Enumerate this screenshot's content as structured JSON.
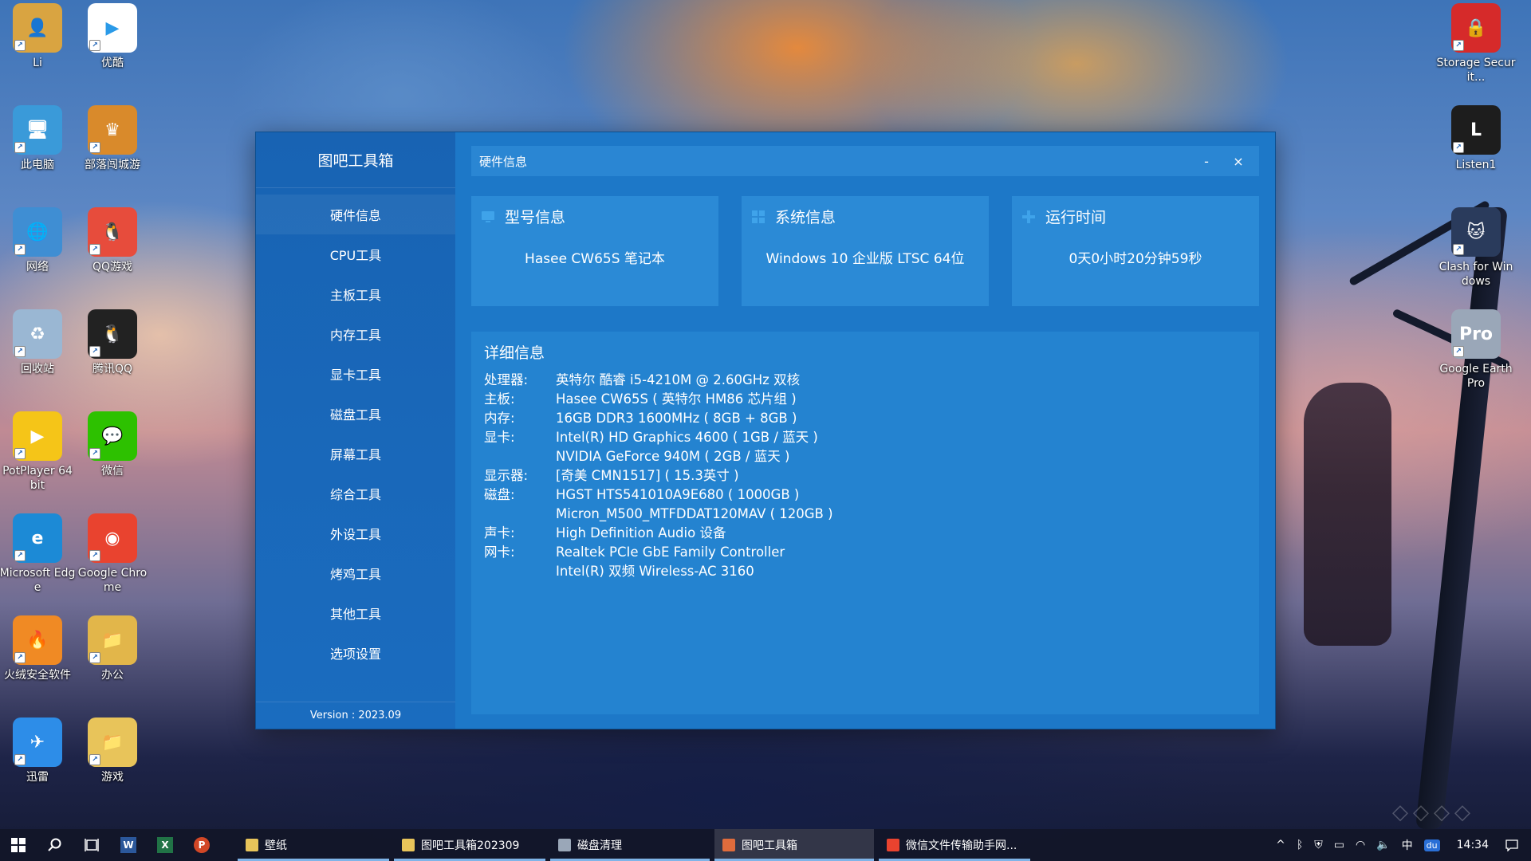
{
  "desktop": {
    "left_icons": [
      {
        "label": "Li",
        "name": "user-folder",
        "color": "#d9a441",
        "glyph": "👤"
      },
      {
        "label": "优酷",
        "name": "youku",
        "color": "#ffffff",
        "glyph": "▶"
      },
      {
        "label": "此电脑",
        "name": "this-pc",
        "color": "#3a9ad9",
        "glyph": "🖥"
      },
      {
        "label": "部落闯城游",
        "name": "game-app",
        "color": "#d98a2b",
        "glyph": "♛"
      },
      {
        "label": "网络",
        "name": "network",
        "color": "#3f8ed3",
        "glyph": "🌐"
      },
      {
        "label": "QQ游戏",
        "name": "qq-game",
        "color": "#e74c3c",
        "glyph": "🐧"
      },
      {
        "label": "回收站",
        "name": "recycle-bin",
        "color": "#9ab7d3",
        "glyph": "♻"
      },
      {
        "label": "腾讯QQ",
        "name": "tencent-qq",
        "color": "#222222",
        "glyph": "🐧"
      },
      {
        "label": "PotPlayer 64 bit",
        "name": "potplayer",
        "color": "#f5c518",
        "glyph": "▶"
      },
      {
        "label": "微信",
        "name": "wechat",
        "color": "#2dc100",
        "glyph": "💬"
      },
      {
        "label": "Microsoft Edge",
        "name": "microsoft-edge",
        "color": "#1c8ad6",
        "glyph": "e"
      },
      {
        "label": "Google Chrome",
        "name": "google-chrome",
        "color": "#e9432f",
        "glyph": "◉"
      },
      {
        "label": "火绒安全软件",
        "name": "huorong",
        "color": "#f08a24",
        "glyph": "🔥"
      },
      {
        "label": "办公",
        "name": "office-folder",
        "color": "#e2b64a",
        "glyph": "📁"
      },
      {
        "label": "迅雷",
        "name": "xunlei",
        "color": "#2d8de8",
        "glyph": "✈"
      },
      {
        "label": "游戏",
        "name": "games-folder",
        "color": "#e8c45a",
        "glyph": "📁"
      }
    ],
    "right_icons": [
      {
        "label": "Storage Securit...",
        "name": "storage-security",
        "color": "#d62a2a",
        "glyph": "🔒"
      },
      {
        "label": "Listen1",
        "name": "listen1",
        "color": "#1d1d1d",
        "glyph": "L"
      },
      {
        "label": "Clash for Windows",
        "name": "clash-for-windows",
        "color": "#2a3b5c",
        "glyph": "🐱"
      },
      {
        "label": "Google Earth Pro",
        "name": "google-earth-pro",
        "color": "#9aa7b8",
        "glyph": "Pro"
      }
    ]
  },
  "app": {
    "title": "图吧工具箱",
    "version": "Version : 2023.09",
    "nav": [
      "硬件信息",
      "CPU工具",
      "主板工具",
      "内存工具",
      "显卡工具",
      "磁盘工具",
      "屏幕工具",
      "综合工具",
      "外设工具",
      "烤鸡工具",
      "其他工具",
      "选项设置"
    ],
    "window_title": "硬件信息",
    "minimize": "-",
    "close": "×",
    "cards": [
      {
        "title": "型号信息",
        "value": "Hasee  CW65S 笔记本",
        "icon": "monitor-icon"
      },
      {
        "title": "系统信息",
        "value": "Windows 10 企业版 LTSC 64位",
        "icon": "windows-icon"
      },
      {
        "title": "运行时间",
        "value": "0天0小时20分钟59秒",
        "icon": "plus-icon"
      }
    ],
    "detail_title": "详细信息",
    "details": [
      {
        "k": "处理器:",
        "v": "英特尔 酷睿 i5-4210M @ 2.60GHz 双核"
      },
      {
        "k": "主板:",
        "v": "Hasee CW65S ( 英特尔 HM86 芯片组 )"
      },
      {
        "k": "内存:",
        "v": "16GB DDR3 1600MHz ( 8GB + 8GB )"
      },
      {
        "k": "显卡:",
        "v": "Intel(R) HD Graphics 4600 ( 1GB / 蓝天 )"
      },
      {
        "k": "",
        "v": "NVIDIA GeForce 940M ( 2GB / 蓝天 )"
      },
      {
        "k": "显示器:",
        "v": "[奇美 CMN1517] ( 15.3英寸 )"
      },
      {
        "k": "磁盘:",
        "v": "HGST HTS541010A9E680 ( 1000GB )"
      },
      {
        "k": "",
        "v": "Micron_M500_MTFDDAT120MAV ( 120GB )"
      },
      {
        "k": "声卡:",
        "v": "High Definition Audio 设备"
      },
      {
        "k": "网卡:",
        "v": "Realtek PCIe GbE Family Controller"
      },
      {
        "k": "",
        "v": "Intel(R) 双频 Wireless-AC 3160"
      }
    ]
  },
  "taskbar": {
    "items": [
      {
        "label": "壁纸",
        "name": "taskbar-wallpaper-folder",
        "color": "#e8c45a"
      },
      {
        "label": "图吧工具箱202309",
        "name": "taskbar-toolbox-folder",
        "color": "#e8c45a"
      },
      {
        "label": "磁盘清理",
        "name": "taskbar-disk-cleanup",
        "color": "#9aa7b8"
      },
      {
        "label": "图吧工具箱",
        "name": "taskbar-toolbox-app",
        "color": "#e06c3c"
      },
      {
        "label": "微信文件传输助手网...",
        "name": "taskbar-chrome-wechat",
        "color": "#e9432f"
      }
    ],
    "ime": "中",
    "time": "14:34"
  },
  "colors": {
    "sidebar": "#1863b3",
    "main": "#1d78c8",
    "card": "#2b8ad6",
    "detail": "#2483d0"
  }
}
